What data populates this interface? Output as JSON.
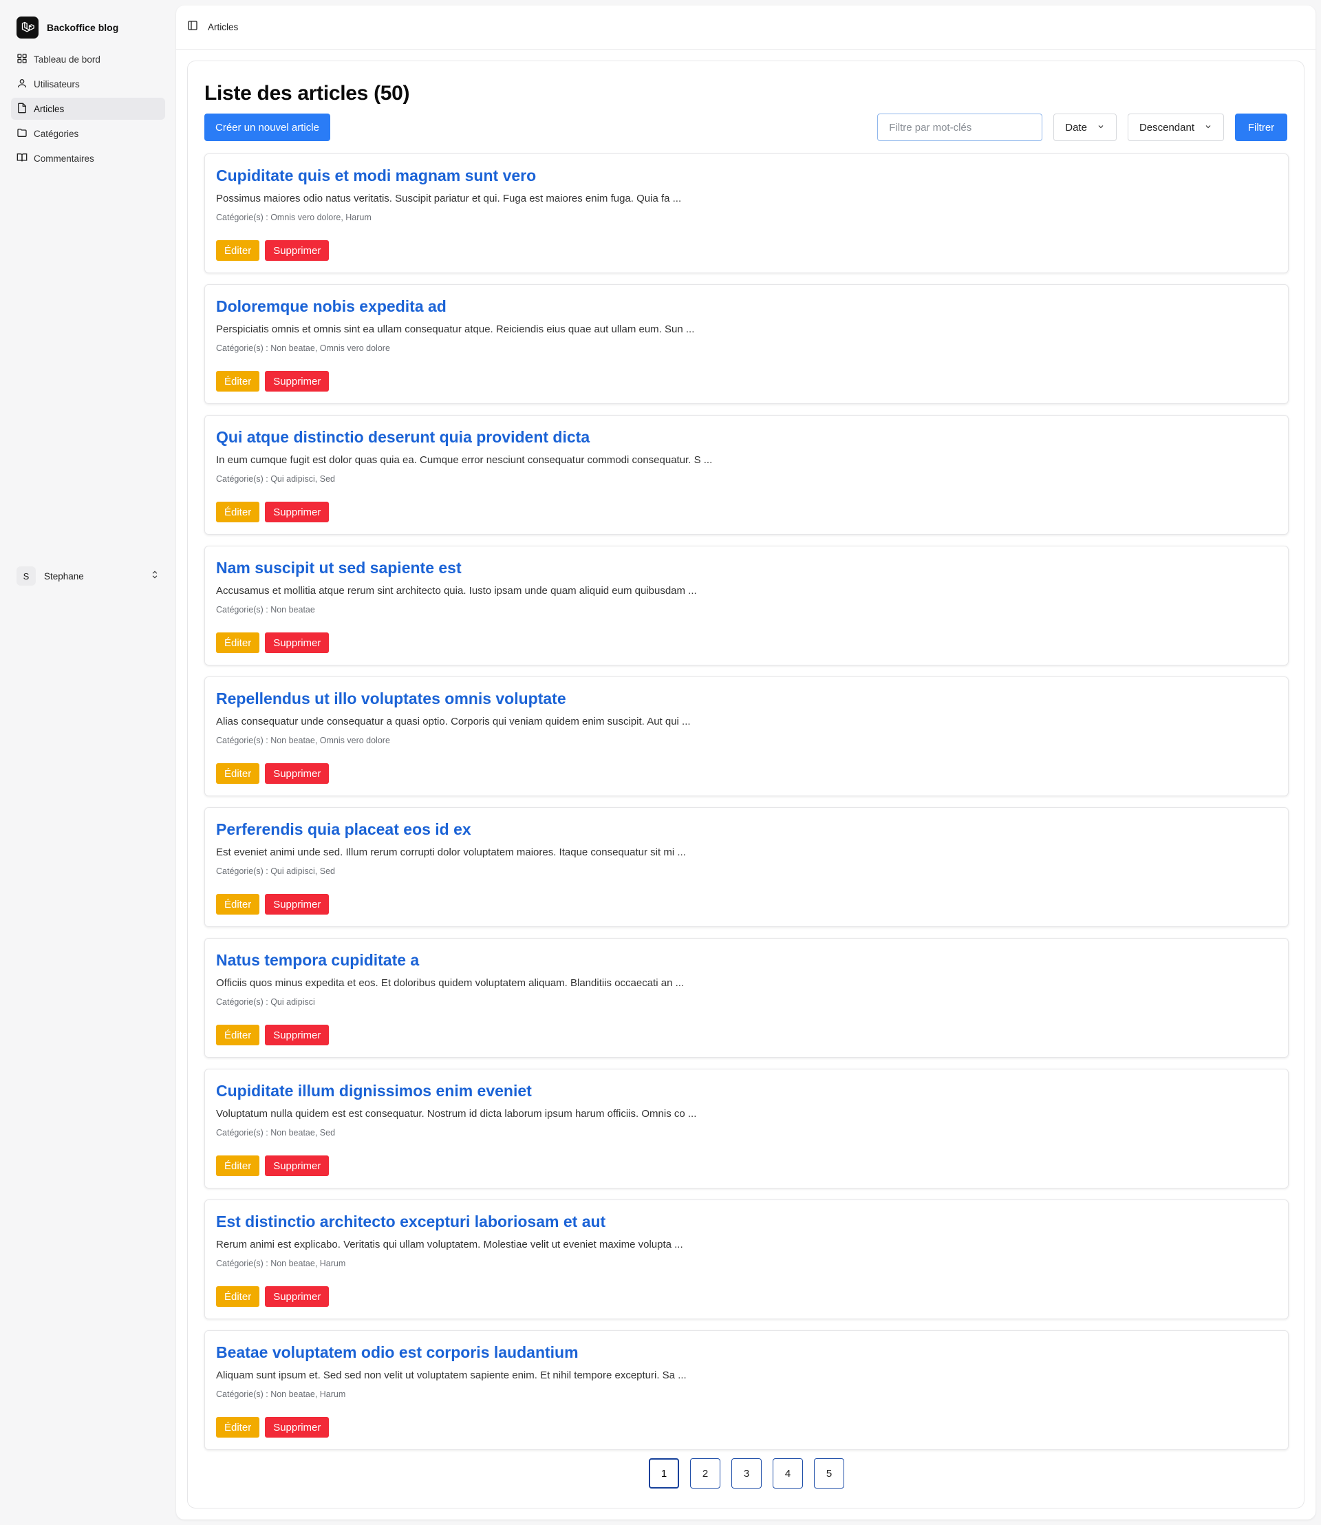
{
  "sidebar": {
    "brand": "Backoffice blog",
    "items": [
      {
        "label": "Tableau de bord"
      },
      {
        "label": "Utilisateurs"
      },
      {
        "label": "Articles"
      },
      {
        "label": "Catégories"
      },
      {
        "label": "Commentaires"
      }
    ],
    "active_item": "Articles",
    "user": {
      "initial": "S",
      "name": "Stephane"
    }
  },
  "header": {
    "breadcrumb": "Articles"
  },
  "main": {
    "title": "Liste des articles (50)",
    "create_label": "Créer un nouvel article",
    "search_placeholder": "Filtre par mot-clés",
    "sort_field": "Date",
    "sort_order": "Descendant",
    "filter_label": "Filtrer",
    "edit_label": "Éditer",
    "delete_label": "Supprimer",
    "articles": [
      {
        "title": "Cupiditate quis et modi magnam sunt vero",
        "excerpt": "Possimus maiores odio natus veritatis. Suscipit pariatur et qui. Fuga est maiores enim fuga. Quia fa ...",
        "categories": "Catégorie(s) : Omnis vero dolore, Harum"
      },
      {
        "title": "Doloremque nobis expedita ad",
        "excerpt": "Perspiciatis omnis et omnis sint ea ullam consequatur atque. Reiciendis eius quae aut ullam eum. Sun ...",
        "categories": "Catégorie(s) : Non beatae, Omnis vero dolore"
      },
      {
        "title": "Qui atque distinctio deserunt quia provident dicta",
        "excerpt": "In eum cumque fugit est dolor quas quia ea. Cumque error nesciunt consequatur commodi consequatur. S ...",
        "categories": "Catégorie(s) : Qui adipisci, Sed"
      },
      {
        "title": "Nam suscipit ut sed sapiente est",
        "excerpt": "Accusamus et mollitia atque rerum sint architecto quia. Iusto ipsam unde quam aliquid eum quibusdam  ...",
        "categories": "Catégorie(s) : Non beatae"
      },
      {
        "title": "Repellendus ut illo voluptates omnis voluptate",
        "excerpt": "Alias consequatur unde consequatur a quasi optio. Corporis qui veniam quidem enim suscipit. Aut qui  ...",
        "categories": "Catégorie(s) : Non beatae, Omnis vero dolore"
      },
      {
        "title": "Perferendis quia placeat eos id ex",
        "excerpt": "Est eveniet animi unde sed. Illum rerum corrupti dolor voluptatem maiores. Itaque consequatur sit mi ...",
        "categories": "Catégorie(s) : Qui adipisci, Sed"
      },
      {
        "title": "Natus tempora cupiditate a",
        "excerpt": "Officiis quos minus expedita et eos. Et doloribus quidem voluptatem aliquam. Blanditiis occaecati an ...",
        "categories": "Catégorie(s) : Qui adipisci"
      },
      {
        "title": "Cupiditate illum dignissimos enim eveniet",
        "excerpt": "Voluptatum nulla quidem est est consequatur. Nostrum id dicta laborum ipsum harum officiis. Omnis co ...",
        "categories": "Catégorie(s) : Non beatae, Sed"
      },
      {
        "title": "Est distinctio architecto excepturi laboriosam et aut",
        "excerpt": "Rerum animi est explicabo. Veritatis qui ullam voluptatem. Molestiae velit ut eveniet maxime volupta ...",
        "categories": "Catégorie(s) : Non beatae, Harum"
      },
      {
        "title": "Beatae voluptatem odio est corporis laudantium",
        "excerpt": "Aliquam sunt ipsum et. Sed sed non velit ut voluptatem sapiente enim. Et nihil tempore excepturi. Sa ...",
        "categories": "Catégorie(s) : Non beatae, Harum"
      }
    ],
    "pagination": {
      "pages": [
        "1",
        "2",
        "3",
        "4",
        "5"
      ],
      "current": "1"
    }
  },
  "colors": {
    "primary": "#2a7cf6",
    "title_link": "#1b63d6",
    "edit": "#f2ab00",
    "delete": "#f22a38"
  },
  "icons": {
    "brand": "laravel-logo-icon",
    "nav": [
      "layout-grid-icon",
      "user-icon",
      "file-icon",
      "folder-icon",
      "book-open-icon"
    ],
    "sidebar_toggle": "panel-left-icon",
    "user_menu": "chevrons-up-down-icon",
    "select": "chevron-down-icon"
  }
}
